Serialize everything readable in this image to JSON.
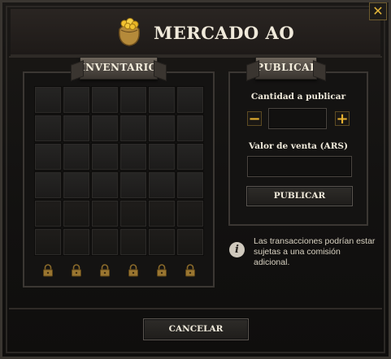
{
  "window": {
    "title": "MERCADO AO",
    "close_label": "✕"
  },
  "inventory": {
    "banner": "INVENTARIO",
    "rows": [
      [
        "empty",
        "empty",
        "empty",
        "empty",
        "empty",
        "empty"
      ],
      [
        "empty",
        "empty",
        "empty",
        "empty",
        "empty",
        "empty"
      ],
      [
        "empty",
        "empty",
        "empty",
        "empty",
        "empty",
        "empty"
      ],
      [
        "empty",
        "empty",
        "empty",
        "empty",
        "empty",
        "empty"
      ],
      [
        "dim",
        "dim",
        "dim",
        "dim",
        "dim",
        "dim"
      ],
      [
        "dim",
        "dim",
        "dim",
        "dim",
        "dim",
        "dim"
      ],
      [
        "locked",
        "locked",
        "locked",
        "locked",
        "locked",
        "locked"
      ]
    ]
  },
  "publish": {
    "banner": "PUBLICAR",
    "quantity_label": "Cantidad a publicar",
    "quantity_value": "",
    "minus_label": "−",
    "plus_label": "+",
    "price_label": "Valor de venta (ARS)",
    "price_value": "",
    "publish_button": "PUBLICAR"
  },
  "info": {
    "icon": "i",
    "text": "Las transacciones podrían estar sujetas a una comisión adicional."
  },
  "footer": {
    "cancel_button": "CANCELAR"
  },
  "colors": {
    "accent": "#e8b230",
    "text": "#f0eadb",
    "panel": "#141312"
  }
}
